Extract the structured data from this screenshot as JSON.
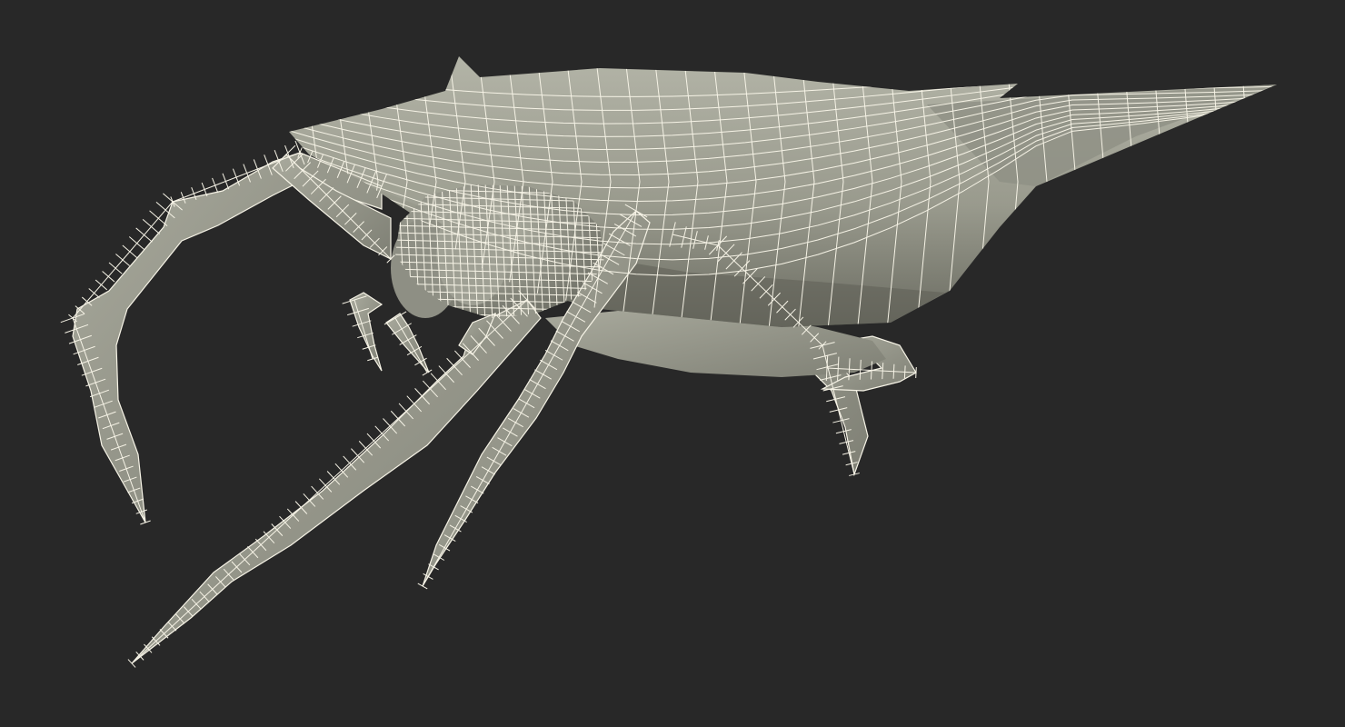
{
  "viewport": {
    "background": "#282828",
    "model_subject": "spider",
    "render_style": "wireframe-over-shaded",
    "wire_color": "#f6f3e6",
    "surface_light": "#a6a79a",
    "surface_mid": "#8b8c80",
    "surface_dark": "#5d5e55"
  }
}
